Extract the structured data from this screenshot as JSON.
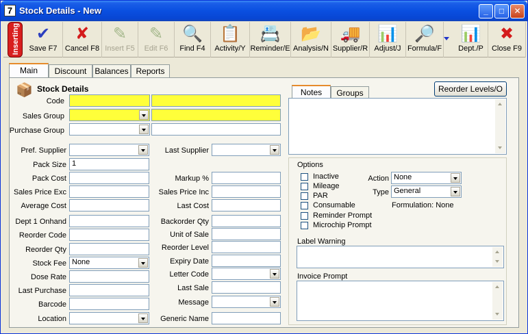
{
  "window": {
    "title": "Stock Details - New",
    "app_icon_glyph": "7"
  },
  "status_tag": "Inserting",
  "toolbar": [
    {
      "label": "Save F7",
      "icon": "save-check-icon",
      "glyph": "✔",
      "color": "#2c3fbf",
      "enabled": true
    },
    {
      "label": "Cancel F8",
      "icon": "cancel-x-icon",
      "glyph": "✘",
      "color": "#d41c1c",
      "enabled": true
    },
    {
      "label": "Insert F5",
      "icon": "insert-icon",
      "glyph": "✎",
      "color": "#4a7a2a",
      "enabled": false
    },
    {
      "label": "Edit F6",
      "icon": "edit-icon",
      "glyph": "✎",
      "color": "#4a7a2a",
      "enabled": false
    },
    {
      "label": "Find F4",
      "icon": "magnifier-icon",
      "glyph": "🔍",
      "color": "#333333",
      "enabled": true
    },
    {
      "label": "Activity/Y",
      "icon": "activity-icon",
      "glyph": "📋",
      "color": "#1b6fb5",
      "enabled": true
    },
    {
      "label": "Reminder/E",
      "icon": "reminder-icon",
      "glyph": "📇",
      "color": "#c07a1a",
      "enabled": true
    },
    {
      "label": "Analysis/N",
      "icon": "analysis-folder-icon",
      "glyph": "📂",
      "color": "#e0a020",
      "enabled": true
    },
    {
      "label": "Supplier/R",
      "icon": "supplier-truck-icon",
      "glyph": "🚚",
      "color": "#c85010",
      "enabled": true
    },
    {
      "label": "Adjust/J",
      "icon": "adjust-icon",
      "glyph": "📊",
      "color": "#2a8a2a",
      "enabled": true
    },
    {
      "label": "Formula/F",
      "icon": "formula-icon",
      "glyph": "🔎",
      "color": "#d0a020",
      "enabled": true
    },
    {
      "label": "Dept./P",
      "icon": "dept-chart-icon",
      "glyph": "📊",
      "color": "#8a2ab0",
      "enabled": true
    },
    {
      "label": "Close F9",
      "icon": "close-circle-icon",
      "glyph": "✖",
      "color": "#d41c1c",
      "enabled": true
    }
  ],
  "tabs": [
    "Main",
    "Discount",
    "Balances",
    "Reports"
  ],
  "main": {
    "heading": "Stock Details",
    "code": {
      "label": "Code",
      "value": "",
      "description": ""
    },
    "sales_group": {
      "label": "Sales Group",
      "value": "",
      "description": ""
    },
    "purchase_group": {
      "label": "Purchase Group",
      "value": "",
      "description": ""
    },
    "left_fields": [
      {
        "label": "Pref. Supplier",
        "value": "",
        "combo": true
      },
      {
        "label": "Pack Size",
        "value": "1",
        "combo": false
      },
      {
        "label": "Pack Cost",
        "value": "",
        "combo": false
      },
      {
        "label": "Sales Price Exc",
        "value": "",
        "combo": false
      },
      {
        "label": "Average Cost",
        "value": "",
        "combo": false
      },
      {
        "label": "Dept 1 Onhand",
        "value": "",
        "combo": false
      },
      {
        "label": "Reorder Code",
        "value": "",
        "combo": false
      },
      {
        "label": "Reorder Qty",
        "value": "",
        "combo": false
      },
      {
        "label": "Stock Fee",
        "value": "None",
        "combo": true
      },
      {
        "label": "Dose Rate",
        "value": "",
        "combo": false
      },
      {
        "label": "Last Purchase",
        "value": "",
        "combo": false
      },
      {
        "label": "Barcode",
        "value": "",
        "combo": false
      },
      {
        "label": "Location",
        "value": "",
        "combo": true
      }
    ],
    "right_fields": [
      {
        "label": "Last Supplier",
        "value": "",
        "combo": true
      },
      {
        "label": "Markup %",
        "value": "",
        "combo": false
      },
      {
        "label": "Sales Price Inc",
        "value": "",
        "combo": false
      },
      {
        "label": "Last Cost",
        "value": "",
        "combo": false
      },
      {
        "label": "Backorder Qty",
        "value": "",
        "combo": false
      },
      {
        "label": "Unit of Sale",
        "value": "",
        "combo": false
      },
      {
        "label": "Reorder Level",
        "value": "",
        "combo": false
      },
      {
        "label": "Expiry Date",
        "value": "",
        "combo": false
      },
      {
        "label": "Letter Code",
        "value": "",
        "combo": true
      },
      {
        "label": "Last Sale",
        "value": "",
        "combo": false
      },
      {
        "label": "Message",
        "value": "",
        "combo": true
      },
      {
        "label": "Generic Name",
        "value": "",
        "combo": false
      }
    ],
    "reorder_button": "Reorder Levels/O",
    "note_tabs": [
      "Notes",
      "Groups"
    ],
    "options": {
      "title": "Options",
      "checkboxes": [
        "Inactive",
        "Mileage",
        "PAR",
        "Consumable",
        "Reminder Prompt",
        "Microchip Prompt"
      ],
      "action": {
        "label": "Action",
        "value": "None"
      },
      "type": {
        "label": "Type",
        "value": "General"
      },
      "formulation": "Formulation: None",
      "label_warning": "Label Warning",
      "invoice_prompt": "Invoice Prompt"
    }
  }
}
